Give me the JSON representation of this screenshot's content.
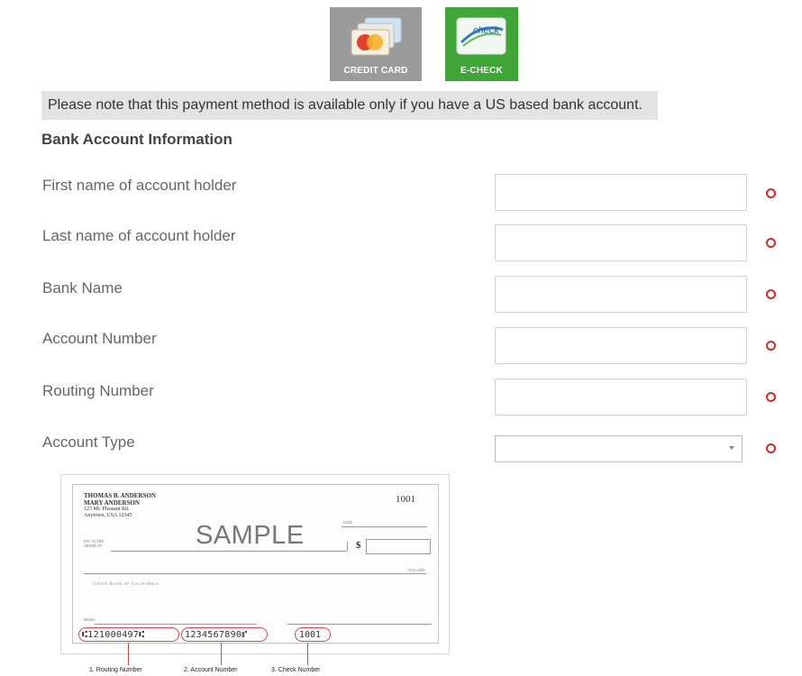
{
  "payment_methods": [
    {
      "label": "CREDIT CARD",
      "icon": "credit-card-icon",
      "color": "#9b9b9b"
    },
    {
      "label": "E-CHECK",
      "icon": "echeck-icon",
      "color": "#3fa536",
      "icon_text": "check"
    }
  ],
  "notice": "Please note that this payment method is available only if you have a US based bank account.",
  "section_title": "Bank Account Information",
  "fields": [
    {
      "label": "First name of account holder",
      "value": ""
    },
    {
      "label": "Last name of account holder",
      "value": ""
    },
    {
      "label": "Bank Name",
      "value": ""
    },
    {
      "label": "Account Number",
      "value": ""
    },
    {
      "label": "Routing Number",
      "value": ""
    },
    {
      "label": "Account Type",
      "value": ""
    }
  ],
  "sample_check": {
    "holder_line1": "THOMAS B. ANDERSON",
    "holder_line2": "MARY ANDERSON",
    "address_line1": "123 Mt. Pleasant Rd.",
    "address_line2": "Anytown, USA 12345",
    "check_no": "1001",
    "date_label": "DATE",
    "payee_label_1": "PAY TO THE",
    "payee_label_2": "ORDER OF",
    "watermark": "SAMPLE",
    "dollar": "$",
    "dollars_label": "DOLLARS",
    "bank_name": "Union Bank of California",
    "memo_label": "MEMO",
    "micr_routing": "⑆121000497⑆",
    "micr_account": "1234567890⑈",
    "micr_check": "1001",
    "captions": [
      "1. Routing Number",
      "2. Account Number",
      "3. Check Number"
    ]
  },
  "colors": {
    "required": "#c9302c",
    "notice_bg": "#e3e3e3",
    "echeck_green": "#3fa536"
  }
}
